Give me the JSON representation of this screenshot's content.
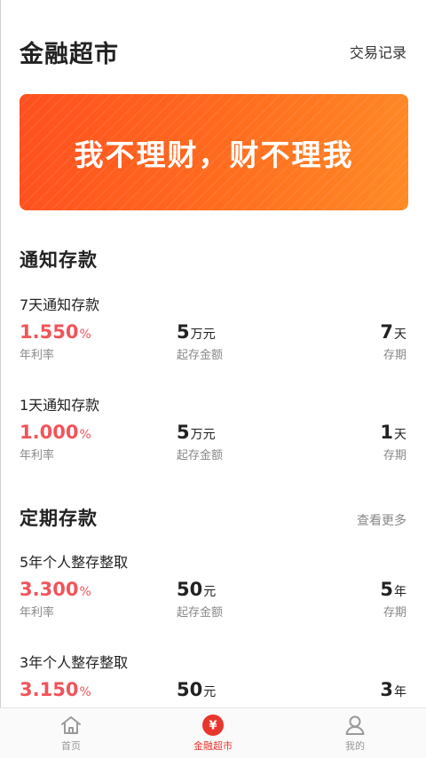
{
  "header": {
    "title": "金融超市",
    "records_link": "交易记录"
  },
  "banner": {
    "slogan": "我不理财，财不理我"
  },
  "sections": {
    "notice": {
      "title": "通知存款"
    },
    "fixed": {
      "title": "定期存款",
      "more": "查看更多"
    }
  },
  "products": [
    {
      "name": "7天通知存款",
      "rate": "1.550",
      "rate_unit": "%",
      "rate_caption": "年利率",
      "min": "5",
      "min_unit": "万元",
      "min_caption": "起存金额",
      "term": "7",
      "term_unit": "天",
      "term_caption": "存期"
    },
    {
      "name": "1天通知存款",
      "rate": "1.000",
      "rate_unit": "%",
      "rate_caption": "年利率",
      "min": "5",
      "min_unit": "万元",
      "min_caption": "起存金额",
      "term": "1",
      "term_unit": "天",
      "term_caption": "存期"
    },
    {
      "name": "5年个人整存整取",
      "rate": "3.300",
      "rate_unit": "%",
      "rate_caption": "年利率",
      "min": "50",
      "min_unit": "元",
      "min_caption": "起存金额",
      "term": "5",
      "term_unit": "年",
      "term_caption": "存期"
    },
    {
      "name": "3年个人整存整取",
      "rate": "3.150",
      "rate_unit": "%",
      "min": "50",
      "min_unit": "元",
      "term": "3",
      "term_unit": "年"
    }
  ],
  "tabs": [
    {
      "label": "首页",
      "icon": "home-icon"
    },
    {
      "label": "金融超市",
      "icon": "yuan-icon",
      "glyph": "¥"
    },
    {
      "label": "我的",
      "icon": "user-icon"
    }
  ],
  "colors": {
    "accent": "#e8362e",
    "rate": "#f0545a",
    "banner_start": "#ff4f1f",
    "banner_end": "#ff8a25"
  }
}
